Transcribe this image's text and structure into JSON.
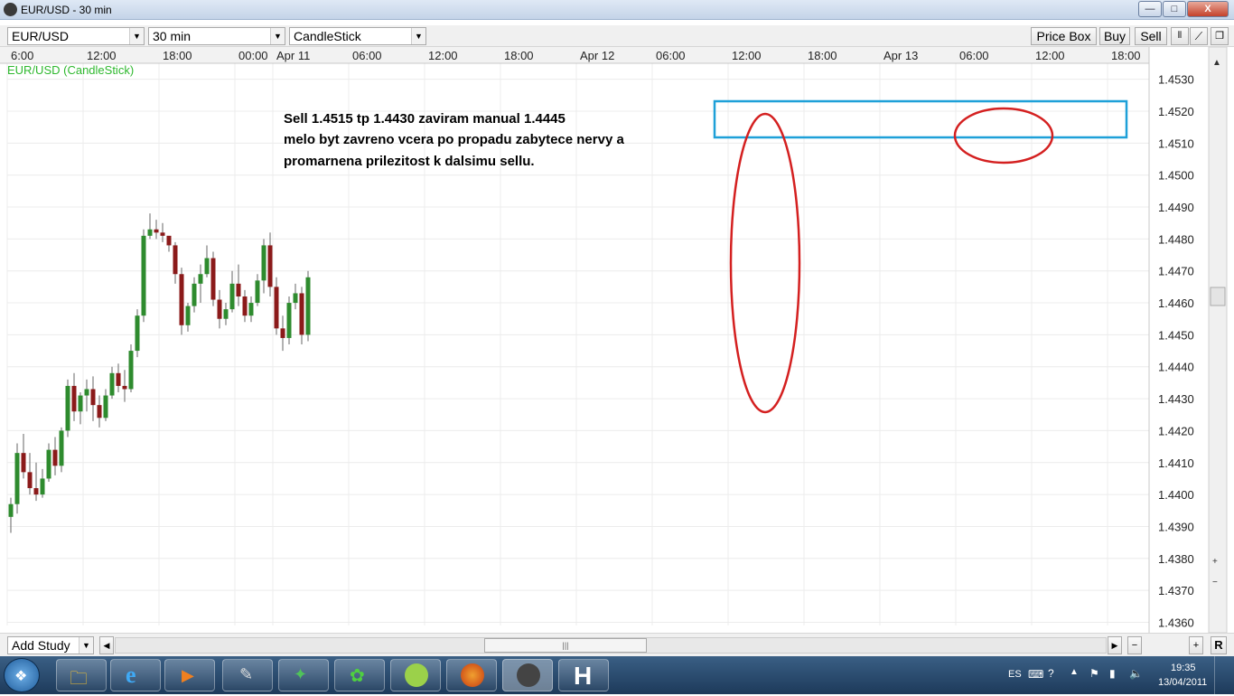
{
  "window": {
    "title": "EUR/USD - 30 min",
    "min": "—",
    "max": "□",
    "close": "X"
  },
  "toolbar": {
    "symbol": "EUR/USD",
    "interval": "30 min",
    "chart_type": "CandleStick",
    "price_box": "Price Box",
    "buy": "Buy",
    "sell": "Sell"
  },
  "chart_label": "EUR/USD (CandleStick)",
  "annotation": [
    "Sell 1.4515 tp 1.4430 zaviram manual 1.4445",
    "melo byt zavreno vcera po propadu zabytece nervy a",
    "promarnena prilezitost k dalsimu sellu."
  ],
  "bottom": {
    "add_study": "Add Study",
    "scroll_center": "|||",
    "r": "R"
  },
  "taskbar": {
    "lang": "ES",
    "time": "19:35",
    "date": "13/04/2011"
  },
  "colors": {
    "up": "#2e8b2e",
    "down": "#8b1a1a",
    "box": "#1ea0d8",
    "circle": "#d42020"
  },
  "chart_data": {
    "type": "candlestick",
    "title": "EUR/USD (CandleStick)",
    "interval": "30 min",
    "y_ticks": [
      1.453,
      1.452,
      1.451,
      1.45,
      1.449,
      1.448,
      1.447,
      1.446,
      1.445,
      1.444,
      1.443,
      1.442,
      1.441,
      1.44,
      1.439,
      1.438,
      1.437,
      1.436
    ],
    "ylim": [
      1.4359,
      1.4535
    ],
    "x_labels": [
      "6:00",
      "12:00",
      "18:00",
      "00:00",
      "Apr 11",
      "06:00",
      "12:00",
      "18:00",
      "Apr 12",
      "06:00",
      "12:00",
      "18:00",
      "Apr 13",
      "06:00",
      "12:00",
      "18:00"
    ],
    "x_label_values": [
      0,
      12,
      24,
      36,
      42,
      54,
      66,
      78,
      90,
      102,
      114,
      126,
      138,
      150,
      162,
      174
    ],
    "x_label_display": [
      "6:00",
      "12:00",
      "18:00",
      "00:00",
      "Apr 11",
      "06:00",
      "12:00",
      "18:00",
      "Apr 12",
      "06:00",
      "12:00",
      "18:00",
      "Apr 13",
      "06:00",
      "12:00",
      "18:00"
    ],
    "candles": [
      [
        1.4393,
        1.4399,
        1.4388,
        1.4397
      ],
      [
        1.4397,
        1.4416,
        1.4394,
        1.4413
      ],
      [
        1.4413,
        1.4419,
        1.4405,
        1.4407
      ],
      [
        1.4407,
        1.4413,
        1.44,
        1.4402
      ],
      [
        1.4402,
        1.441,
        1.4398,
        1.44
      ],
      [
        1.44,
        1.4408,
        1.4399,
        1.4405
      ],
      [
        1.4405,
        1.4416,
        1.4404,
        1.4414
      ],
      [
        1.4414,
        1.4418,
        1.4406,
        1.4409
      ],
      [
        1.4409,
        1.4421,
        1.4407,
        1.442
      ],
      [
        1.442,
        1.4436,
        1.4418,
        1.4434
      ],
      [
        1.4434,
        1.4438,
        1.4423,
        1.4426
      ],
      [
        1.4426,
        1.4432,
        1.4422,
        1.4431
      ],
      [
        1.4431,
        1.4436,
        1.4426,
        1.4433
      ],
      [
        1.4433,
        1.4437,
        1.4423,
        1.4428
      ],
      [
        1.4428,
        1.4431,
        1.4421,
        1.4424
      ],
      [
        1.4424,
        1.4433,
        1.4423,
        1.4431
      ],
      [
        1.4431,
        1.444,
        1.443,
        1.4438
      ],
      [
        1.4438,
        1.4441,
        1.4432,
        1.4434
      ],
      [
        1.4434,
        1.4439,
        1.4429,
        1.4433
      ],
      [
        1.4433,
        1.4447,
        1.4432,
        1.4445
      ],
      [
        1.4445,
        1.4458,
        1.4443,
        1.4456
      ],
      [
        1.4456,
        1.4483,
        1.4454,
        1.4481
      ],
      [
        1.4481,
        1.4488,
        1.448,
        1.4483
      ],
      [
        1.4483,
        1.4486,
        1.448,
        1.4482
      ],
      [
        1.4482,
        1.4485,
        1.4479,
        1.4481
      ],
      [
        1.4481,
        1.448,
        1.4476,
        1.4478
      ],
      [
        1.4478,
        1.4479,
        1.4466,
        1.4469
      ],
      [
        1.4469,
        1.4471,
        1.445,
        1.4453
      ],
      [
        1.4453,
        1.446,
        1.4451,
        1.4459
      ],
      [
        1.4459,
        1.4468,
        1.4457,
        1.4466
      ],
      [
        1.4466,
        1.4472,
        1.446,
        1.4469
      ],
      [
        1.4469,
        1.4478,
        1.4468,
        1.4474
      ],
      [
        1.4474,
        1.4476,
        1.4459,
        1.4461
      ],
      [
        1.4461,
        1.4464,
        1.4452,
        1.4455
      ],
      [
        1.4455,
        1.446,
        1.4453,
        1.4458
      ],
      [
        1.4458,
        1.447,
        1.4457,
        1.4466
      ],
      [
        1.4466,
        1.4472,
        1.4459,
        1.4462
      ],
      [
        1.4462,
        1.4464,
        1.4454,
        1.4456
      ],
      [
        1.4456,
        1.4462,
        1.4454,
        1.446
      ],
      [
        1.446,
        1.4469,
        1.4459,
        1.4467
      ],
      [
        1.4467,
        1.448,
        1.4463,
        1.4478
      ],
      [
        1.4478,
        1.4482,
        1.4462,
        1.4465
      ],
      [
        1.4465,
        1.4468,
        1.445,
        1.4452
      ],
      [
        1.4452,
        1.4456,
        1.4445,
        1.4449
      ],
      [
        1.4449,
        1.4462,
        1.4447,
        1.446
      ],
      [
        1.446,
        1.4466,
        1.4458,
        1.4463
      ],
      [
        1.4463,
        1.4465,
        1.4447,
        1.445
      ],
      [
        1.445,
        1.447,
        1.4448,
        1.4468
      ]
    ]
  }
}
